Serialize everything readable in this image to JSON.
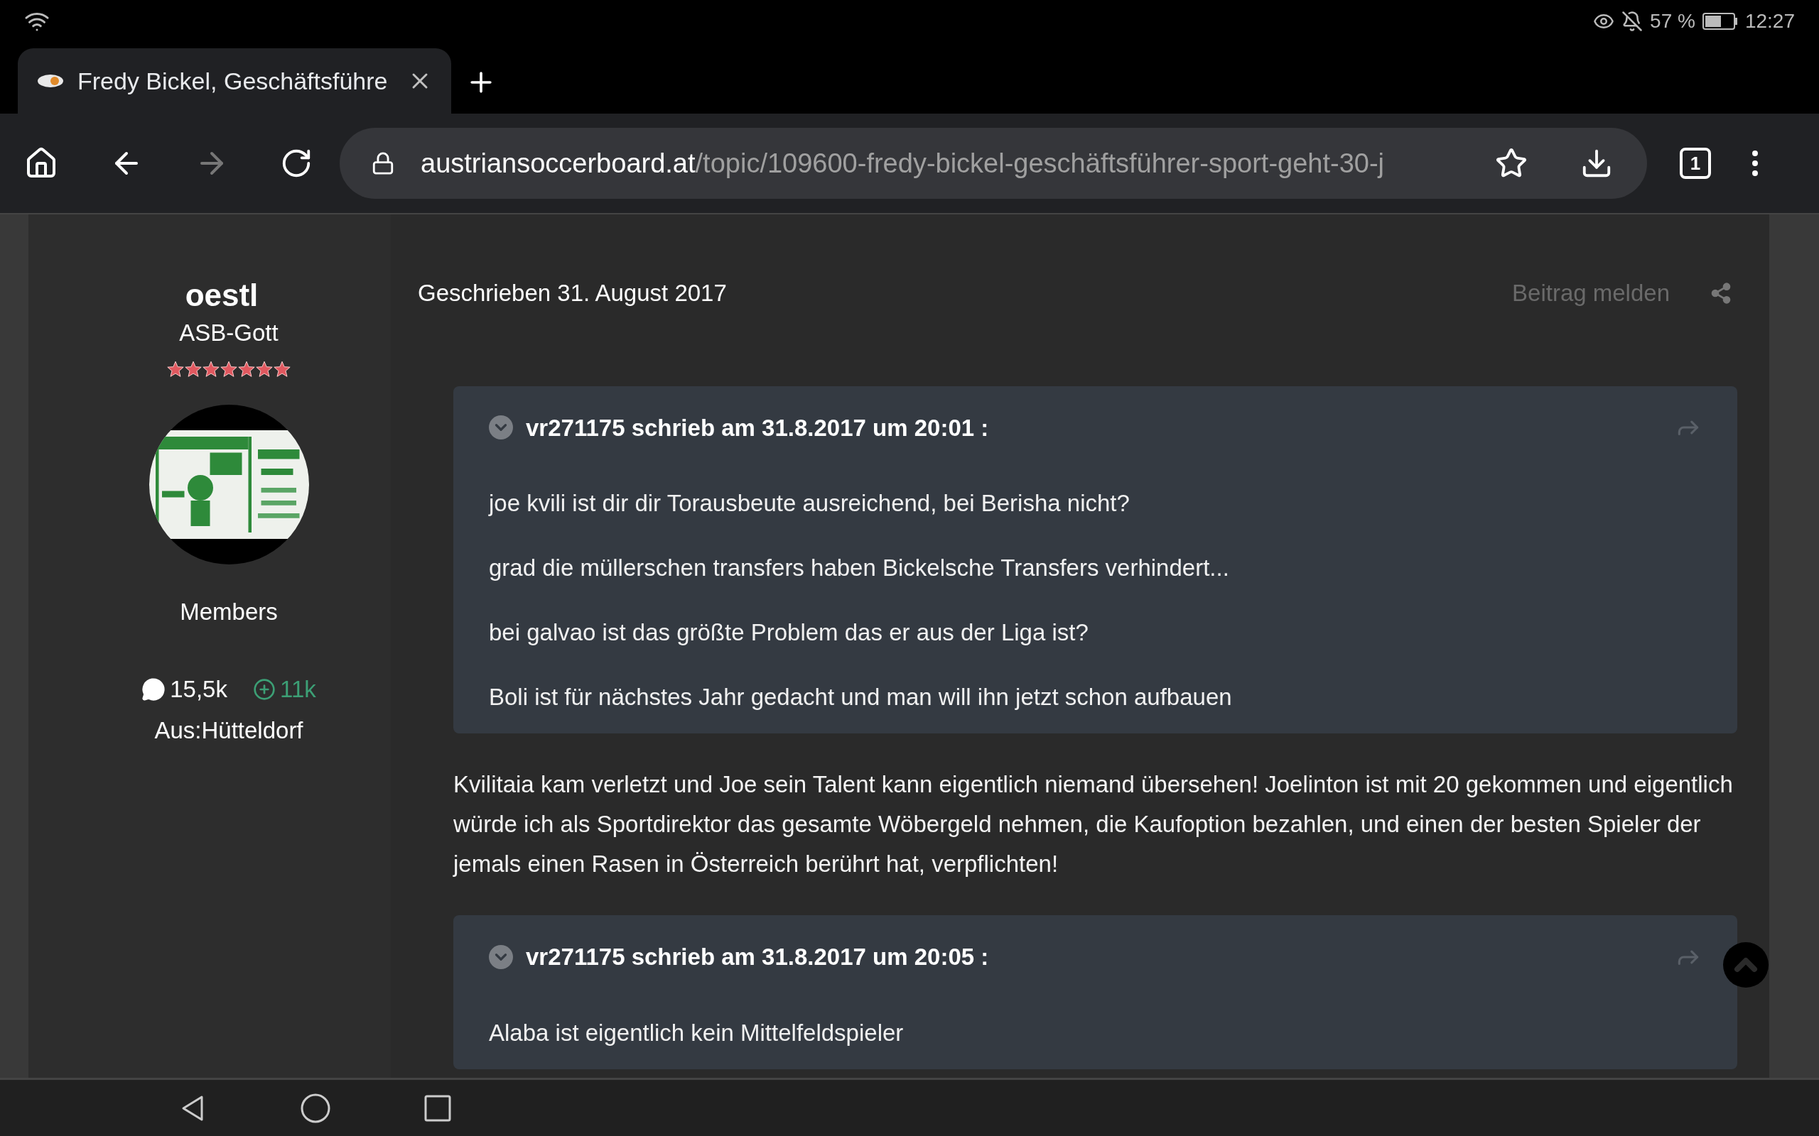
{
  "status_bar": {
    "battery": "57 %",
    "time": "12:27"
  },
  "browser": {
    "tabs": [
      {
        "title": "Fredy Bickel, Geschäftsführe",
        "selected": true
      }
    ],
    "url_host": "austriansoccerboard.at",
    "url_path": "/topic/109600-fredy-bickel-geschäftsführer-sport-geht-30-j",
    "tab_count": "1"
  },
  "author": {
    "name": "oestl",
    "rank": "ASB-Gott",
    "stars": 7,
    "group": "Members",
    "posts": "15,5k",
    "reputation": "11k",
    "location": "Aus:Hütteldorf"
  },
  "post": {
    "date": "Geschrieben 31. August 2017",
    "report": "Beitrag melden",
    "blocks": [
      {
        "kind": "quote",
        "header": "vr271175 schrieb am 31.8.2017 um 20:01 :",
        "lines": [
          "joe kvili ist dir dir Torausbeute ausreichend, bei Berisha nicht?",
          "grad die müllerschen transfers haben Bickelsche Transfers verhindert...",
          "bei galvao ist das größte Problem das er aus der Liga ist?",
          "Boli ist für nächstes Jahr gedacht und man will ihn jetzt schon aufbauen"
        ]
      },
      {
        "kind": "paragraph",
        "text": "Kvilitaia kam verletzt und Joe sein Talent kann eigentlich niemand übersehen! Joelinton ist mit 20 gekommen und eigentlich würde ich als Sportdirektor das gesamte Wöbergeld nehmen, die Kaufoption bezahlen, und einen der besten Spieler der jemals einen Rasen in Österreich berührt hat, verpflichten!"
      },
      {
        "kind": "quote",
        "header": "vr271175 schrieb am 31.8.2017 um 20:05 :",
        "lines": [
          "Alaba ist eigentlich kein Mittelfeldspieler"
        ]
      }
    ]
  }
}
